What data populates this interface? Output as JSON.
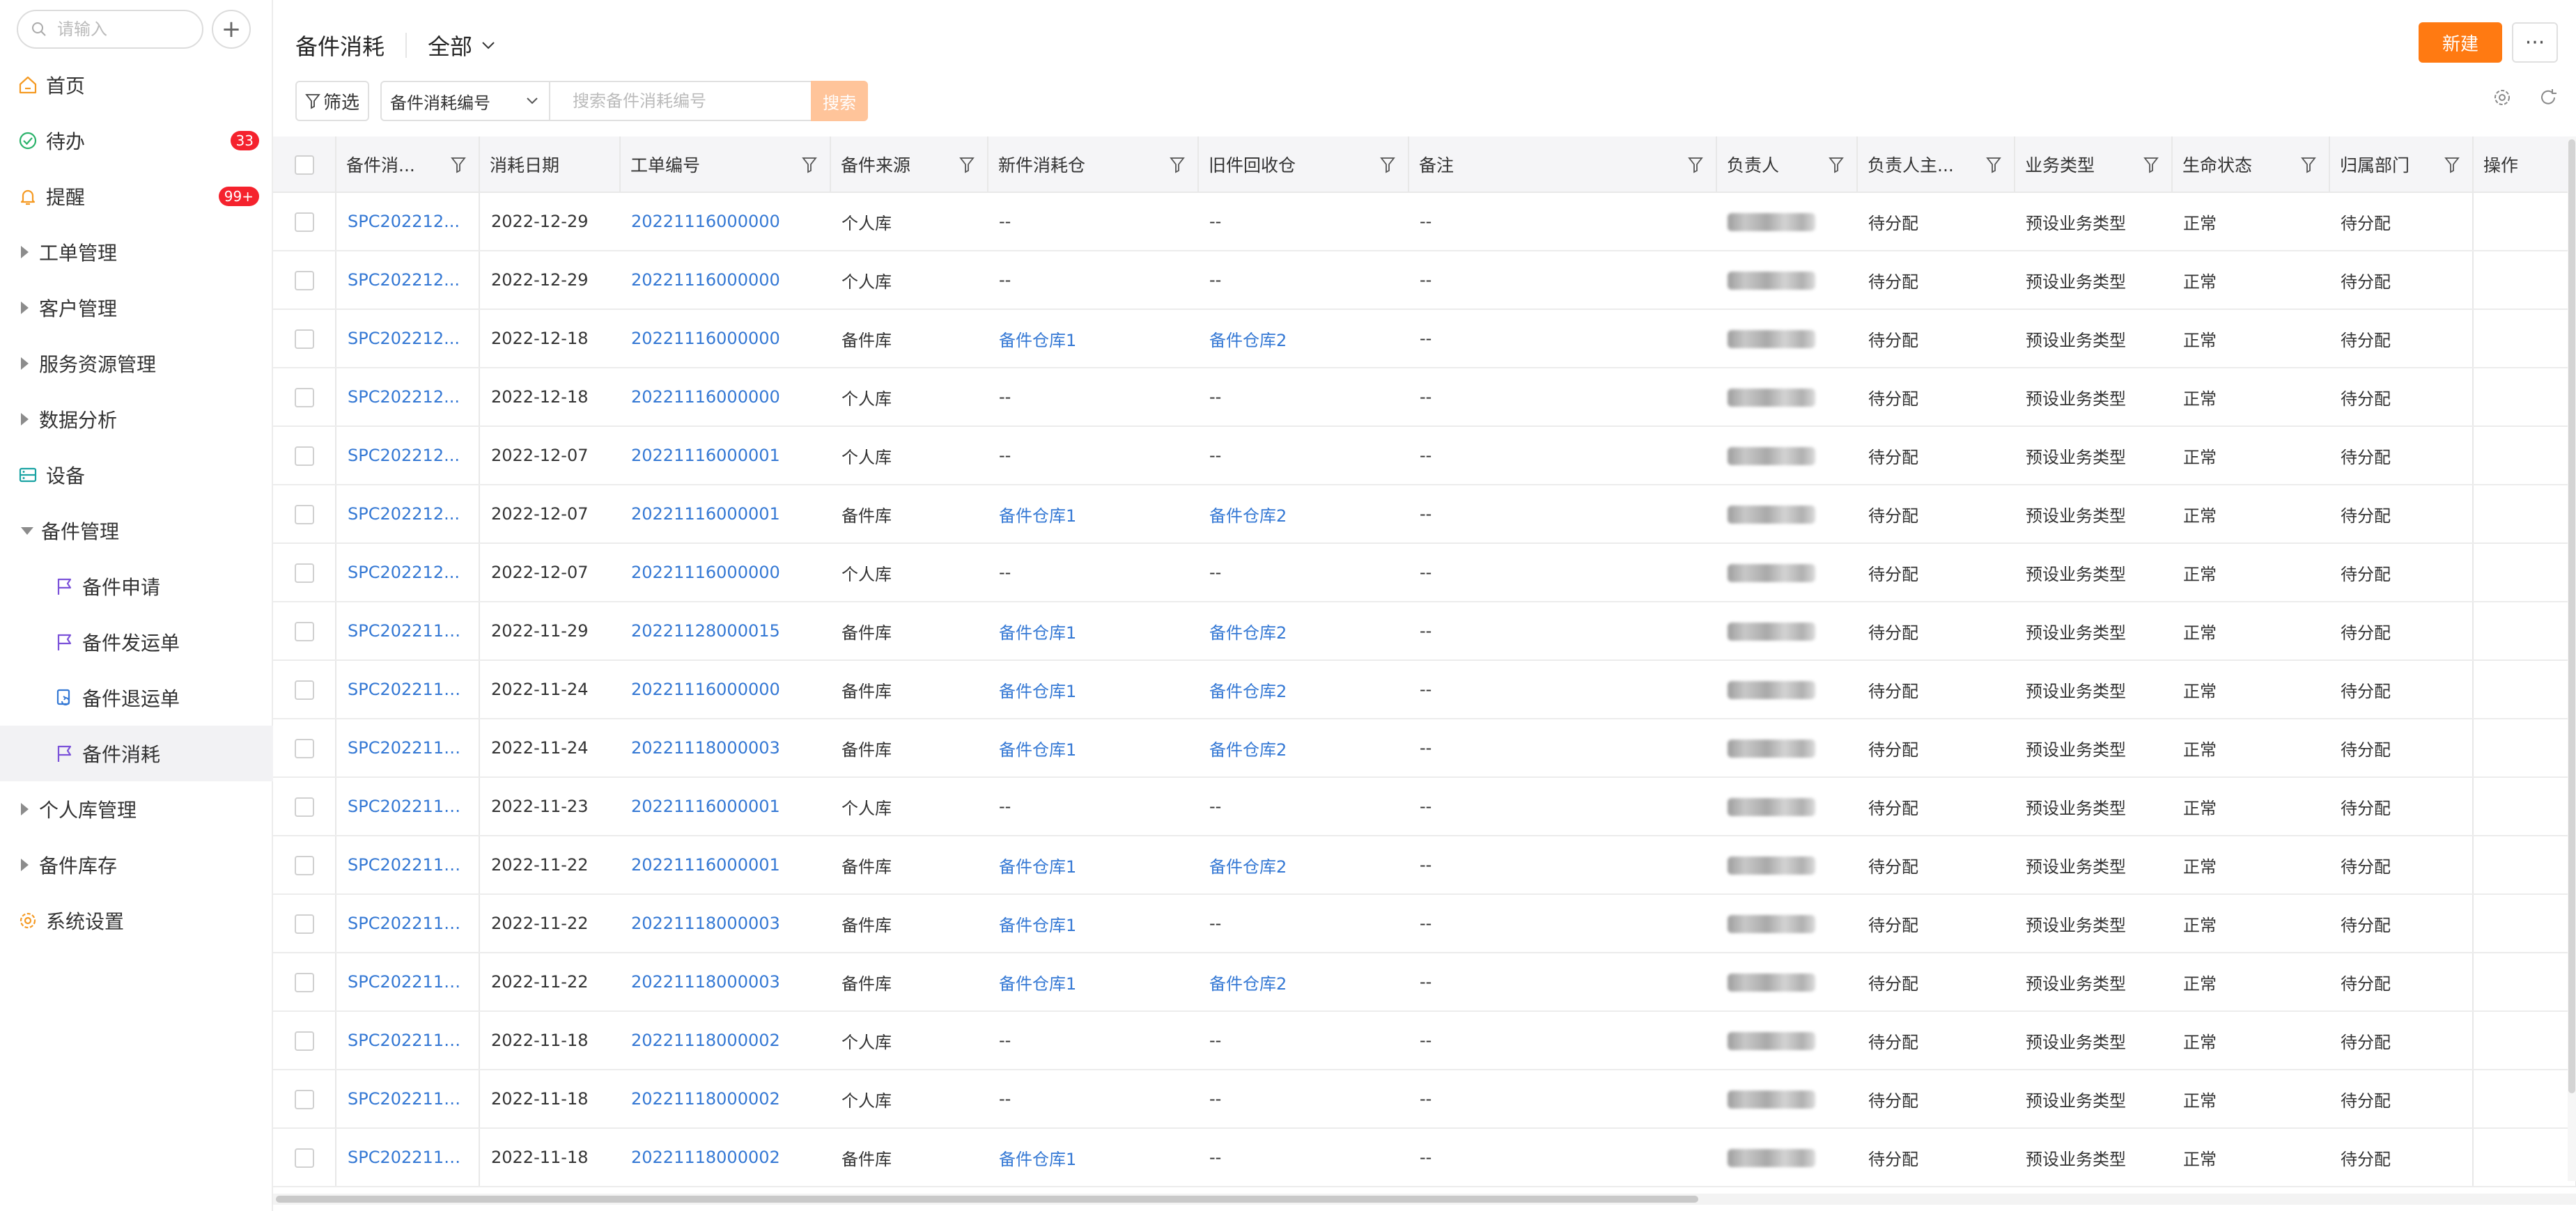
{
  "sidebar": {
    "search_placeholder": "请输入",
    "add_label": "+",
    "items": [
      {
        "label": "首页",
        "icon": "home-icon",
        "kind": "top"
      },
      {
        "label": "待办",
        "icon": "check-circle-icon",
        "kind": "top",
        "badge": "33"
      },
      {
        "label": "提醒",
        "icon": "bell-icon",
        "kind": "top",
        "badge": "99+"
      },
      {
        "label": "工单管理",
        "kind": "group"
      },
      {
        "label": "客户管理",
        "kind": "group"
      },
      {
        "label": "服务资源管理",
        "kind": "group"
      },
      {
        "label": "数据分析",
        "kind": "group"
      },
      {
        "label": "设备",
        "icon": "device-icon",
        "kind": "top"
      },
      {
        "label": "备件管理",
        "kind": "group-open"
      },
      {
        "label": "备件申请",
        "icon": "flag-icon",
        "kind": "sub"
      },
      {
        "label": "备件发运单",
        "icon": "flag-icon",
        "kind": "sub"
      },
      {
        "label": "备件退运单",
        "icon": "return-doc-icon",
        "kind": "sub"
      },
      {
        "label": "备件消耗",
        "icon": "flag-icon",
        "kind": "sub",
        "active": true
      },
      {
        "label": "个人库管理",
        "kind": "group"
      },
      {
        "label": "备件库存",
        "kind": "group"
      },
      {
        "label": "系统设置",
        "icon": "gear-icon",
        "kind": "top"
      }
    ]
  },
  "header": {
    "title": "备件消耗",
    "scope": "全部",
    "new_label": "新建",
    "more_label": "···"
  },
  "toolbar": {
    "filter_label": "筛选",
    "field_label": "备件消耗编号",
    "search_placeholder": "搜索备件消耗编号",
    "search_label": "搜索"
  },
  "table": {
    "columns": [
      "备件消...",
      "消耗日期",
      "工单编号",
      "备件来源",
      "新件消耗仓",
      "旧件回收仓",
      "备注",
      "负责人",
      "负责人主...",
      "业务类型",
      "生命状态",
      "归属部门",
      "操作"
    ],
    "rows": [
      {
        "id": "SPC202212...",
        "date": "2022-12-29",
        "order": "20221116000000",
        "source": "个人库",
        "new_wh": "--",
        "old_wh": "--",
        "note": "--",
        "owner_dept": "待分配",
        "biz": "预设业务类型",
        "status": "正常",
        "dept": "待分配"
      },
      {
        "id": "SPC202212...",
        "date": "2022-12-29",
        "order": "20221116000000",
        "source": "个人库",
        "new_wh": "--",
        "old_wh": "--",
        "note": "--",
        "owner_dept": "待分配",
        "biz": "预设业务类型",
        "status": "正常",
        "dept": "待分配"
      },
      {
        "id": "SPC202212...",
        "date": "2022-12-18",
        "order": "20221116000000",
        "source": "备件库",
        "new_wh": "备件仓库1",
        "old_wh": "备件仓库2",
        "note": "--",
        "owner_dept": "待分配",
        "biz": "预设业务类型",
        "status": "正常",
        "dept": "待分配"
      },
      {
        "id": "SPC202212...",
        "date": "2022-12-18",
        "order": "20221116000000",
        "source": "个人库",
        "new_wh": "--",
        "old_wh": "--",
        "note": "--",
        "owner_dept": "待分配",
        "biz": "预设业务类型",
        "status": "正常",
        "dept": "待分配"
      },
      {
        "id": "SPC202212...",
        "date": "2022-12-07",
        "order": "20221116000001",
        "source": "个人库",
        "new_wh": "--",
        "old_wh": "--",
        "note": "--",
        "owner_dept": "待分配",
        "biz": "预设业务类型",
        "status": "正常",
        "dept": "待分配"
      },
      {
        "id": "SPC202212...",
        "date": "2022-12-07",
        "order": "20221116000001",
        "source": "备件库",
        "new_wh": "备件仓库1",
        "old_wh": "备件仓库2",
        "note": "--",
        "owner_dept": "待分配",
        "biz": "预设业务类型",
        "status": "正常",
        "dept": "待分配"
      },
      {
        "id": "SPC202212...",
        "date": "2022-12-07",
        "order": "20221116000000",
        "source": "个人库",
        "new_wh": "--",
        "old_wh": "--",
        "note": "--",
        "owner_dept": "待分配",
        "biz": "预设业务类型",
        "status": "正常",
        "dept": "待分配"
      },
      {
        "id": "SPC2022112...",
        "date": "2022-11-29",
        "order": "20221128000015",
        "source": "备件库",
        "new_wh": "备件仓库1",
        "old_wh": "备件仓库2",
        "note": "--",
        "owner_dept": "待分配",
        "biz": "预设业务类型",
        "status": "正常",
        "dept": "待分配"
      },
      {
        "id": "SPC2022112...",
        "date": "2022-11-24",
        "order": "20221116000000",
        "source": "备件库",
        "new_wh": "备件仓库1",
        "old_wh": "备件仓库2",
        "note": "--",
        "owner_dept": "待分配",
        "biz": "预设业务类型",
        "status": "正常",
        "dept": "待分配"
      },
      {
        "id": "SPC2022112...",
        "date": "2022-11-24",
        "order": "20221118000003",
        "source": "备件库",
        "new_wh": "备件仓库1",
        "old_wh": "备件仓库2",
        "note": "--",
        "owner_dept": "待分配",
        "biz": "预设业务类型",
        "status": "正常",
        "dept": "待分配"
      },
      {
        "id": "SPC2022112...",
        "date": "2022-11-23",
        "order": "20221116000001",
        "source": "个人库",
        "new_wh": "--",
        "old_wh": "--",
        "note": "--",
        "owner_dept": "待分配",
        "biz": "预设业务类型",
        "status": "正常",
        "dept": "待分配"
      },
      {
        "id": "SPC2022112...",
        "date": "2022-11-22",
        "order": "20221116000001",
        "source": "备件库",
        "new_wh": "备件仓库1",
        "old_wh": "备件仓库2",
        "note": "--",
        "owner_dept": "待分配",
        "biz": "预设业务类型",
        "status": "正常",
        "dept": "待分配"
      },
      {
        "id": "SPC2022112...",
        "date": "2022-11-22",
        "order": "20221118000003",
        "source": "备件库",
        "new_wh": "备件仓库1",
        "old_wh": "--",
        "note": "--",
        "owner_dept": "待分配",
        "biz": "预设业务类型",
        "status": "正常",
        "dept": "待分配"
      },
      {
        "id": "SPC2022112...",
        "date": "2022-11-22",
        "order": "20221118000003",
        "source": "备件库",
        "new_wh": "备件仓库1",
        "old_wh": "备件仓库2",
        "note": "--",
        "owner_dept": "待分配",
        "biz": "预设业务类型",
        "status": "正常",
        "dept": "待分配"
      },
      {
        "id": "SPC2022111...",
        "date": "2022-11-18",
        "order": "20221118000002",
        "source": "个人库",
        "new_wh": "--",
        "old_wh": "--",
        "note": "--",
        "owner_dept": "待分配",
        "biz": "预设业务类型",
        "status": "正常",
        "dept": "待分配"
      },
      {
        "id": "SPC2022111...",
        "date": "2022-11-18",
        "order": "20221118000002",
        "source": "个人库",
        "new_wh": "--",
        "old_wh": "--",
        "note": "--",
        "owner_dept": "待分配",
        "biz": "预设业务类型",
        "status": "正常",
        "dept": "待分配"
      },
      {
        "id": "SPC2022111...",
        "date": "2022-11-18",
        "order": "20221118000002",
        "source": "备件库",
        "new_wh": "备件仓库1",
        "old_wh": "--",
        "note": "--",
        "owner_dept": "待分配",
        "biz": "预设业务类型",
        "status": "正常",
        "dept": "待分配"
      }
    ]
  },
  "colors": {
    "accent": "#ff7a12",
    "link": "#3478d4",
    "badge": "#f5222d",
    "icon_purple": "#7b52d9",
    "icon_orange": "#f59a23",
    "icon_green": "#2ab26a",
    "icon_teal": "#1aa3a3"
  }
}
